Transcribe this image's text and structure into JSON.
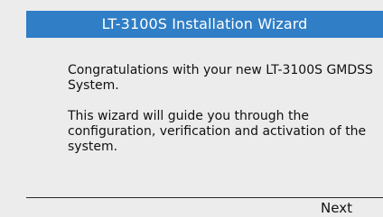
{
  "window": {
    "title": "LT-3100S Installation Wizard"
  },
  "content": {
    "paragraph1": "Congratulations with your new LT-3100S GMDSS System.",
    "paragraph2": "This wizard will guide you through the configuration, verification and activation of the system."
  },
  "footer": {
    "next_label": "Next"
  },
  "colors": {
    "title_bar": "#2f7ec6",
    "background": "#ececec"
  }
}
